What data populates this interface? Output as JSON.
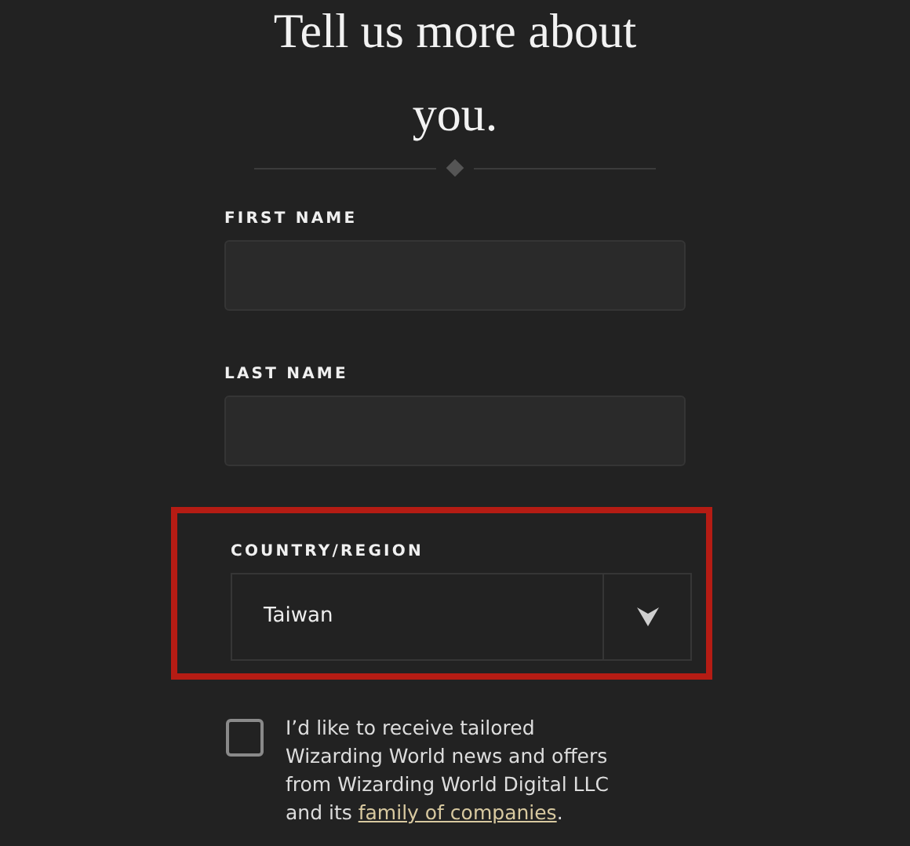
{
  "heading": "Tell us more about you.",
  "fields": [
    {
      "kind": "text",
      "label": "FIRST NAME",
      "highlighted": false
    },
    {
      "kind": "text",
      "label": "LAST NAME",
      "highlighted": false
    },
    {
      "kind": "select",
      "label": "COUNTRY/REGION",
      "value": "Taiwan",
      "highlighted": true
    }
  ],
  "consent": {
    "checked": false,
    "text": "I’d like to receive tailored Wizarding World news and offers from Wizarding World Digital LLC and its ",
    "link": "family of companies",
    "after": "."
  }
}
